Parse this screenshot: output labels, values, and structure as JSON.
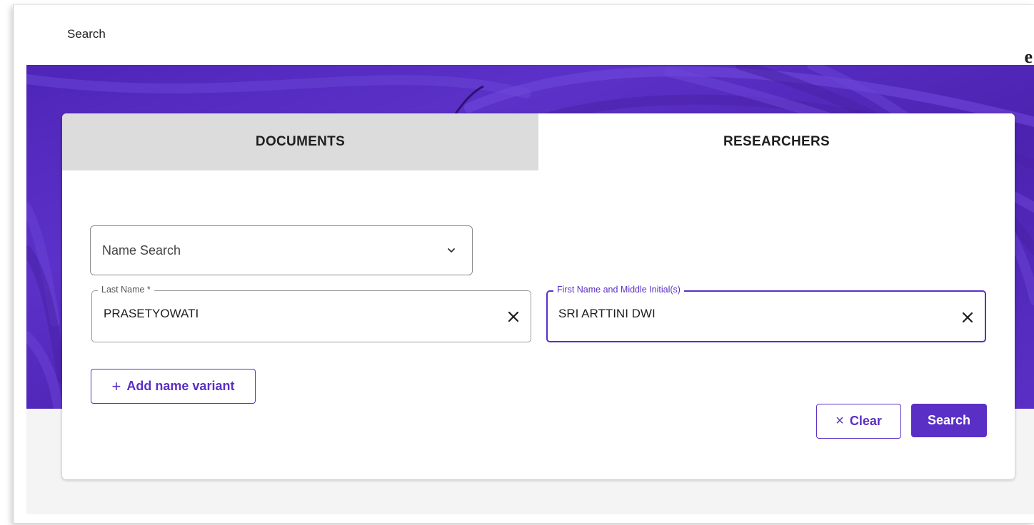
{
  "header": {
    "title": "Search",
    "brand_glyph": "e"
  },
  "tabs": [
    {
      "label": "DOCUMENTS",
      "active": false
    },
    {
      "label": "RESEARCHERS",
      "active": true
    }
  ],
  "search_type": {
    "selected": "Name Search",
    "icon": "chevron-down-icon"
  },
  "fields": {
    "last_name": {
      "label": "Last Name *",
      "value": "PRASETYOWATI",
      "clear_icon": "close-icon"
    },
    "first_name": {
      "label": "First Name and Middle Initial(s)",
      "value": "SRI ARTTINI DWI",
      "clear_icon": "close-icon"
    }
  },
  "actions": {
    "add_variant_icon": "+",
    "add_variant_label": "Add name variant",
    "clear_icon": "×",
    "clear_label": "Clear",
    "search_label": "Search"
  },
  "colors": {
    "accent": "#5a2fc5",
    "hero": "#4f25b8",
    "inactive_tab": "#dcdcdc"
  }
}
